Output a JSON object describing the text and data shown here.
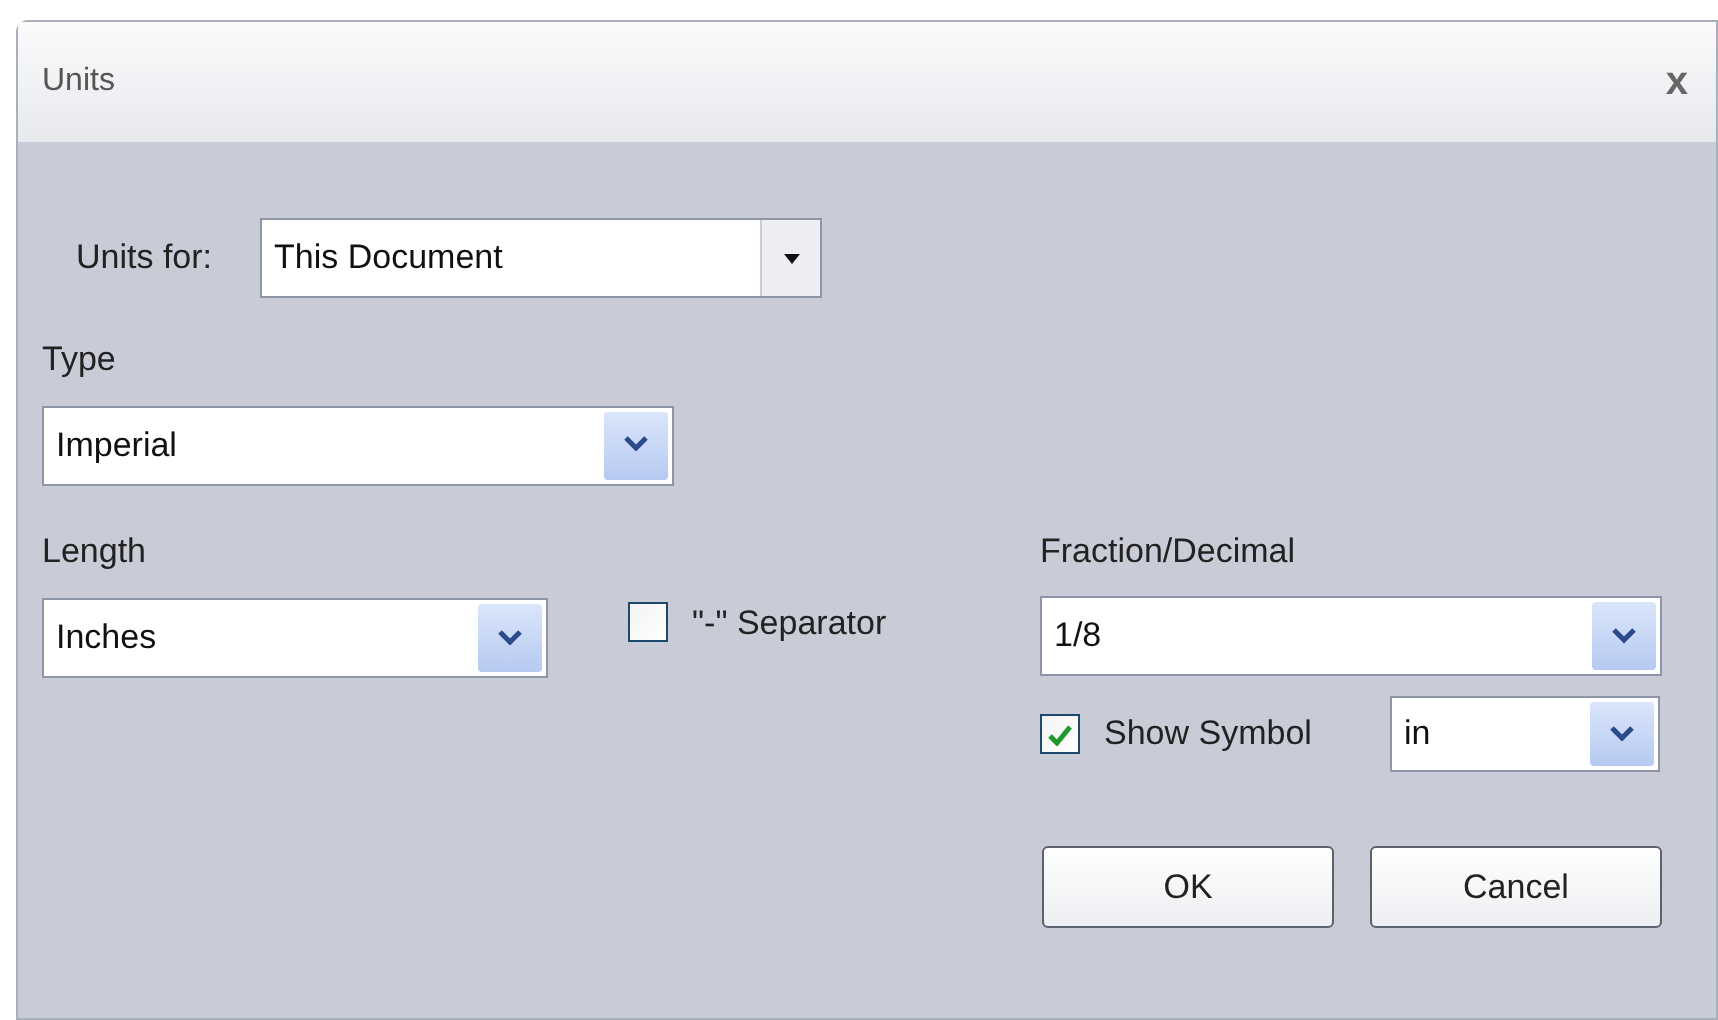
{
  "window": {
    "title": "Units",
    "close": "x"
  },
  "units_for": {
    "label": "Units for:",
    "value": "This Document",
    "kind": "plain"
  },
  "type": {
    "label": "Type",
    "value": "Imperial",
    "kind": "themed"
  },
  "length": {
    "label": "Length",
    "value": "Inches",
    "kind": "themed"
  },
  "separator": {
    "label": "\"-\" Separator",
    "checked": false
  },
  "fraction": {
    "label": "Fraction/Decimal",
    "value": "1/8",
    "kind": "themed"
  },
  "show_symbol": {
    "label": "Show Symbol",
    "checked": true,
    "value": "in",
    "kind": "themed"
  },
  "buttons": [
    "OK",
    "Cancel"
  ]
}
